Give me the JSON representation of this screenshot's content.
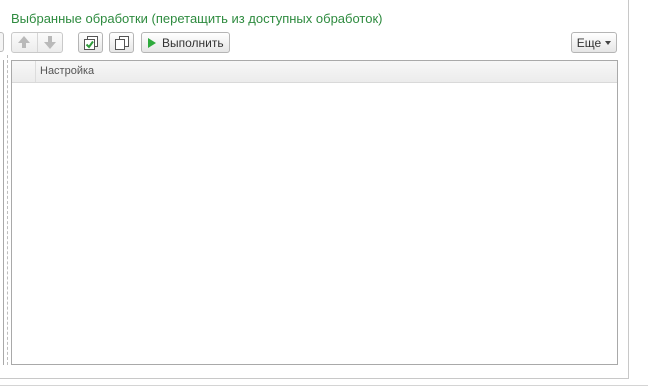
{
  "panel": {
    "title": "Выбранные обработки (перетащить из доступных обработок)"
  },
  "toolbar": {
    "move_up": "arrow-up-icon",
    "move_down": "arrow-down-icon",
    "check_all": "check-all-icon",
    "copy": "copy-icon",
    "run_label": "Выполнить",
    "more_label": "Еще"
  },
  "table": {
    "columns": [
      "Настройка"
    ],
    "rows": []
  },
  "colors": {
    "title": "#2e8b3f",
    "run_icon": "#2eaa3c"
  }
}
